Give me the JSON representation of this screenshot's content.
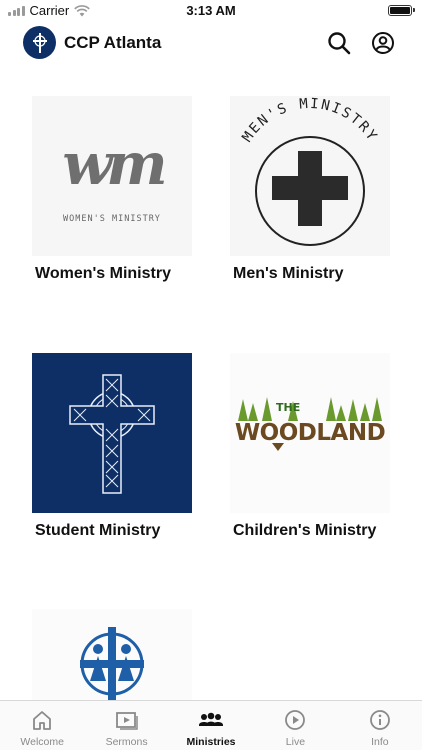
{
  "status_bar": {
    "carrier": "Carrier",
    "time": "3:13 AM"
  },
  "header": {
    "title": "CCP Atlanta",
    "search_icon": "search-icon",
    "account_icon": "account-icon"
  },
  "ministries": [
    {
      "label": "Women's Ministry",
      "logo_text": "WOMEN'S MINISTRY"
    },
    {
      "label": "Men's Ministry",
      "logo_text": "MEN'S MINISTRY"
    },
    {
      "label": "Student Ministry"
    },
    {
      "label": "Children's Ministry",
      "logo_text_the": "THE",
      "logo_text_main": "WOODLAND"
    },
    {
      "label": ""
    }
  ],
  "tabs": [
    {
      "label": "Welcome",
      "icon": "home-icon",
      "active": false
    },
    {
      "label": "Sermons",
      "icon": "video-icon",
      "active": false
    },
    {
      "label": "Ministries",
      "icon": "people-icon",
      "active": true
    },
    {
      "label": "Live",
      "icon": "play-icon",
      "active": false
    },
    {
      "label": "Info",
      "icon": "info-icon",
      "active": false
    }
  ],
  "colors": {
    "brand_navy": "#0d2f66",
    "card_bg": "#f6f6f6",
    "woodland_green": "#6a9a2e",
    "woodland_brown": "#6b4a22",
    "accent_blue": "#1f5fa8"
  }
}
